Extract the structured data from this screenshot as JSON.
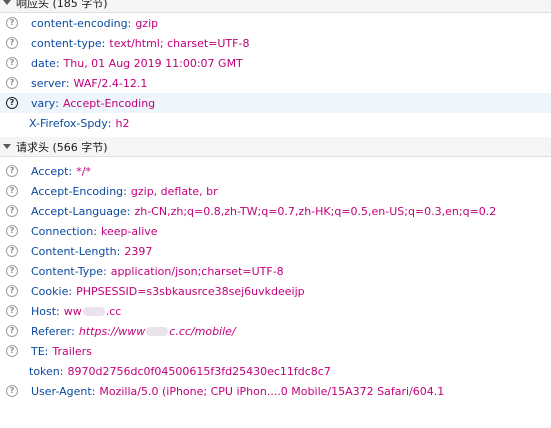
{
  "response": {
    "header_label": "响应头 (185 字节)",
    "rows": [
      {
        "name": "content-encoding",
        "value": "gzip"
      },
      {
        "name": "content-type",
        "value": "text/html; charset=UTF-8"
      },
      {
        "name": "date",
        "value": "Thu, 01 Aug 2019 11:00:07 GMT"
      },
      {
        "name": "server",
        "value": "WAF/2.4-12.1"
      },
      {
        "name": "vary",
        "value": "Accept-Encoding"
      },
      {
        "name": "X-Firefox-Spdy",
        "value": "h2"
      }
    ]
  },
  "request": {
    "header_label": "请求头 (566 字节)",
    "rows": [
      {
        "name": "Accept",
        "value": "*/*"
      },
      {
        "name": "Accept-Encoding",
        "value": "gzip, deflate, br"
      },
      {
        "name": "Accept-Language",
        "value": "zh-CN,zh;q=0.8,zh-TW;q=0.7,zh-HK;q=0.5,en-US;q=0.3,en;q=0.2"
      },
      {
        "name": "Connection",
        "value": "keep-alive"
      },
      {
        "name": "Content-Length",
        "value": "2397"
      },
      {
        "name": "Content-Type",
        "value": "application/json;charset=UTF-8"
      },
      {
        "name": "Cookie",
        "value": "PHPSESSID=s3sbkausrce38sej6uvkdeeijp"
      },
      {
        "name": "Host",
        "value_pre": "ww",
        "value_post": ".cc"
      },
      {
        "name": "Referer",
        "value_pre": "https://www",
        "value_post": "c.cc/mobile/"
      },
      {
        "name": "TE",
        "value": "Trailers"
      },
      {
        "name": "token",
        "value": "8970d2756dc0f04500615f3fd25430ec11fdc8c7"
      },
      {
        "name": "User-Agent",
        "value": "Mozilla/5.0 (iPhone; CPU iPhon....0 Mobile/15A372 Safari/604.1"
      }
    ]
  },
  "icons": {
    "help": "question-circle-icon",
    "toggle": "twisty-down-icon"
  },
  "colors": {
    "header_name": "#0a4aa0",
    "header_value": "#c2007a",
    "selected_row": "#eef5fd"
  }
}
